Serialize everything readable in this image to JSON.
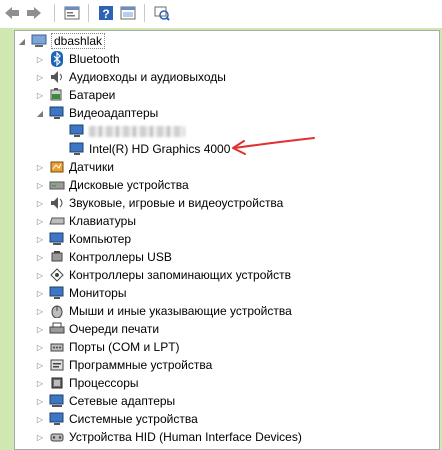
{
  "toolbar": {
    "buttons": [
      "back-icon",
      "forward-icon",
      "properties-icon",
      "help-icon",
      "show-hidden-icon",
      "scan-hardware-icon"
    ]
  },
  "tree": {
    "root": "dbashlak",
    "items": [
      {
        "label": "Bluetooth",
        "icon": "bluetooth-icon",
        "expanded": false
      },
      {
        "label": "Аудиовходы и аудиовыходы",
        "icon": "speaker-icon",
        "expanded": false
      },
      {
        "label": "Батареи",
        "icon": "battery-icon",
        "expanded": false
      },
      {
        "label": "Видеоадаптеры",
        "icon": "display-adapter-icon",
        "expanded": true,
        "children": [
          {
            "label": "",
            "icon": "display-adapter-icon",
            "blurred": true
          },
          {
            "label": "Intel(R) HD Graphics 4000",
            "icon": "display-adapter-icon"
          }
        ]
      },
      {
        "label": "Датчики",
        "icon": "sensor-icon",
        "expanded": false
      },
      {
        "label": "Дисковые устройства",
        "icon": "disk-icon",
        "expanded": false
      },
      {
        "label": "Звуковые, игровые и видеоустройства",
        "icon": "sound-icon",
        "expanded": false
      },
      {
        "label": "Клавиатуры",
        "icon": "keyboard-icon",
        "expanded": false
      },
      {
        "label": "Компьютер",
        "icon": "computer-icon",
        "expanded": false
      },
      {
        "label": "Контроллеры USB",
        "icon": "usb-icon",
        "expanded": false
      },
      {
        "label": "Контроллеры запоминающих устройств",
        "icon": "storage-controller-icon",
        "expanded": false
      },
      {
        "label": "Мониторы",
        "icon": "monitor-icon",
        "expanded": false
      },
      {
        "label": "Мыши и иные указывающие устройства",
        "icon": "mouse-icon",
        "expanded": false
      },
      {
        "label": "Очереди печати",
        "icon": "printer-icon",
        "expanded": false
      },
      {
        "label": "Порты (COM и LPT)",
        "icon": "port-icon",
        "expanded": false
      },
      {
        "label": "Программные устройства",
        "icon": "software-device-icon",
        "expanded": false
      },
      {
        "label": "Процессоры",
        "icon": "processor-icon",
        "expanded": false
      },
      {
        "label": "Сетевые адаптеры",
        "icon": "network-adapter-icon",
        "expanded": false
      },
      {
        "label": "Системные устройства",
        "icon": "system-device-icon",
        "expanded": false
      },
      {
        "label": "Устройства HID (Human Interface Devices)",
        "icon": "hid-icon",
        "expanded": false
      }
    ]
  },
  "colors": {
    "annotation_arrow": "#e03030",
    "window_frame": "#cfe8b2"
  }
}
